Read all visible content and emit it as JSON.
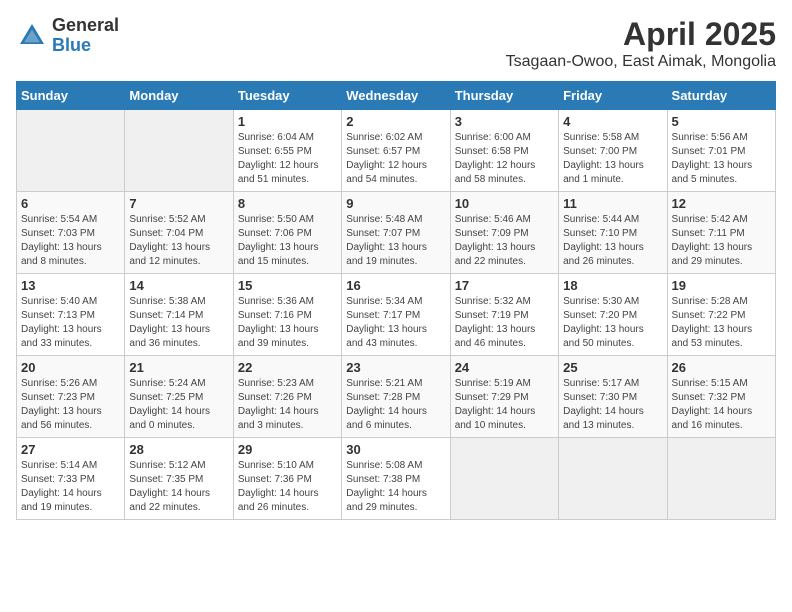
{
  "header": {
    "logo_general": "General",
    "logo_blue": "Blue",
    "month_year": "April 2025",
    "location": "Tsagaan-Owoo, East Aimak, Mongolia"
  },
  "days_of_week": [
    "Sunday",
    "Monday",
    "Tuesday",
    "Wednesday",
    "Thursday",
    "Friday",
    "Saturday"
  ],
  "weeks": [
    [
      {
        "day": "",
        "detail": ""
      },
      {
        "day": "",
        "detail": ""
      },
      {
        "day": "1",
        "detail": "Sunrise: 6:04 AM\nSunset: 6:55 PM\nDaylight: 12 hours\nand 51 minutes."
      },
      {
        "day": "2",
        "detail": "Sunrise: 6:02 AM\nSunset: 6:57 PM\nDaylight: 12 hours\nand 54 minutes."
      },
      {
        "day": "3",
        "detail": "Sunrise: 6:00 AM\nSunset: 6:58 PM\nDaylight: 12 hours\nand 58 minutes."
      },
      {
        "day": "4",
        "detail": "Sunrise: 5:58 AM\nSunset: 7:00 PM\nDaylight: 13 hours\nand 1 minute."
      },
      {
        "day": "5",
        "detail": "Sunrise: 5:56 AM\nSunset: 7:01 PM\nDaylight: 13 hours\nand 5 minutes."
      }
    ],
    [
      {
        "day": "6",
        "detail": "Sunrise: 5:54 AM\nSunset: 7:03 PM\nDaylight: 13 hours\nand 8 minutes."
      },
      {
        "day": "7",
        "detail": "Sunrise: 5:52 AM\nSunset: 7:04 PM\nDaylight: 13 hours\nand 12 minutes."
      },
      {
        "day": "8",
        "detail": "Sunrise: 5:50 AM\nSunset: 7:06 PM\nDaylight: 13 hours\nand 15 minutes."
      },
      {
        "day": "9",
        "detail": "Sunrise: 5:48 AM\nSunset: 7:07 PM\nDaylight: 13 hours\nand 19 minutes."
      },
      {
        "day": "10",
        "detail": "Sunrise: 5:46 AM\nSunset: 7:09 PM\nDaylight: 13 hours\nand 22 minutes."
      },
      {
        "day": "11",
        "detail": "Sunrise: 5:44 AM\nSunset: 7:10 PM\nDaylight: 13 hours\nand 26 minutes."
      },
      {
        "day": "12",
        "detail": "Sunrise: 5:42 AM\nSunset: 7:11 PM\nDaylight: 13 hours\nand 29 minutes."
      }
    ],
    [
      {
        "day": "13",
        "detail": "Sunrise: 5:40 AM\nSunset: 7:13 PM\nDaylight: 13 hours\nand 33 minutes."
      },
      {
        "day": "14",
        "detail": "Sunrise: 5:38 AM\nSunset: 7:14 PM\nDaylight: 13 hours\nand 36 minutes."
      },
      {
        "day": "15",
        "detail": "Sunrise: 5:36 AM\nSunset: 7:16 PM\nDaylight: 13 hours\nand 39 minutes."
      },
      {
        "day": "16",
        "detail": "Sunrise: 5:34 AM\nSunset: 7:17 PM\nDaylight: 13 hours\nand 43 minutes."
      },
      {
        "day": "17",
        "detail": "Sunrise: 5:32 AM\nSunset: 7:19 PM\nDaylight: 13 hours\nand 46 minutes."
      },
      {
        "day": "18",
        "detail": "Sunrise: 5:30 AM\nSunset: 7:20 PM\nDaylight: 13 hours\nand 50 minutes."
      },
      {
        "day": "19",
        "detail": "Sunrise: 5:28 AM\nSunset: 7:22 PM\nDaylight: 13 hours\nand 53 minutes."
      }
    ],
    [
      {
        "day": "20",
        "detail": "Sunrise: 5:26 AM\nSunset: 7:23 PM\nDaylight: 13 hours\nand 56 minutes."
      },
      {
        "day": "21",
        "detail": "Sunrise: 5:24 AM\nSunset: 7:25 PM\nDaylight: 14 hours\nand 0 minutes."
      },
      {
        "day": "22",
        "detail": "Sunrise: 5:23 AM\nSunset: 7:26 PM\nDaylight: 14 hours\nand 3 minutes."
      },
      {
        "day": "23",
        "detail": "Sunrise: 5:21 AM\nSunset: 7:28 PM\nDaylight: 14 hours\nand 6 minutes."
      },
      {
        "day": "24",
        "detail": "Sunrise: 5:19 AM\nSunset: 7:29 PM\nDaylight: 14 hours\nand 10 minutes."
      },
      {
        "day": "25",
        "detail": "Sunrise: 5:17 AM\nSunset: 7:30 PM\nDaylight: 14 hours\nand 13 minutes."
      },
      {
        "day": "26",
        "detail": "Sunrise: 5:15 AM\nSunset: 7:32 PM\nDaylight: 14 hours\nand 16 minutes."
      }
    ],
    [
      {
        "day": "27",
        "detail": "Sunrise: 5:14 AM\nSunset: 7:33 PM\nDaylight: 14 hours\nand 19 minutes."
      },
      {
        "day": "28",
        "detail": "Sunrise: 5:12 AM\nSunset: 7:35 PM\nDaylight: 14 hours\nand 22 minutes."
      },
      {
        "day": "29",
        "detail": "Sunrise: 5:10 AM\nSunset: 7:36 PM\nDaylight: 14 hours\nand 26 minutes."
      },
      {
        "day": "30",
        "detail": "Sunrise: 5:08 AM\nSunset: 7:38 PM\nDaylight: 14 hours\nand 29 minutes."
      },
      {
        "day": "",
        "detail": ""
      },
      {
        "day": "",
        "detail": ""
      },
      {
        "day": "",
        "detail": ""
      }
    ]
  ]
}
